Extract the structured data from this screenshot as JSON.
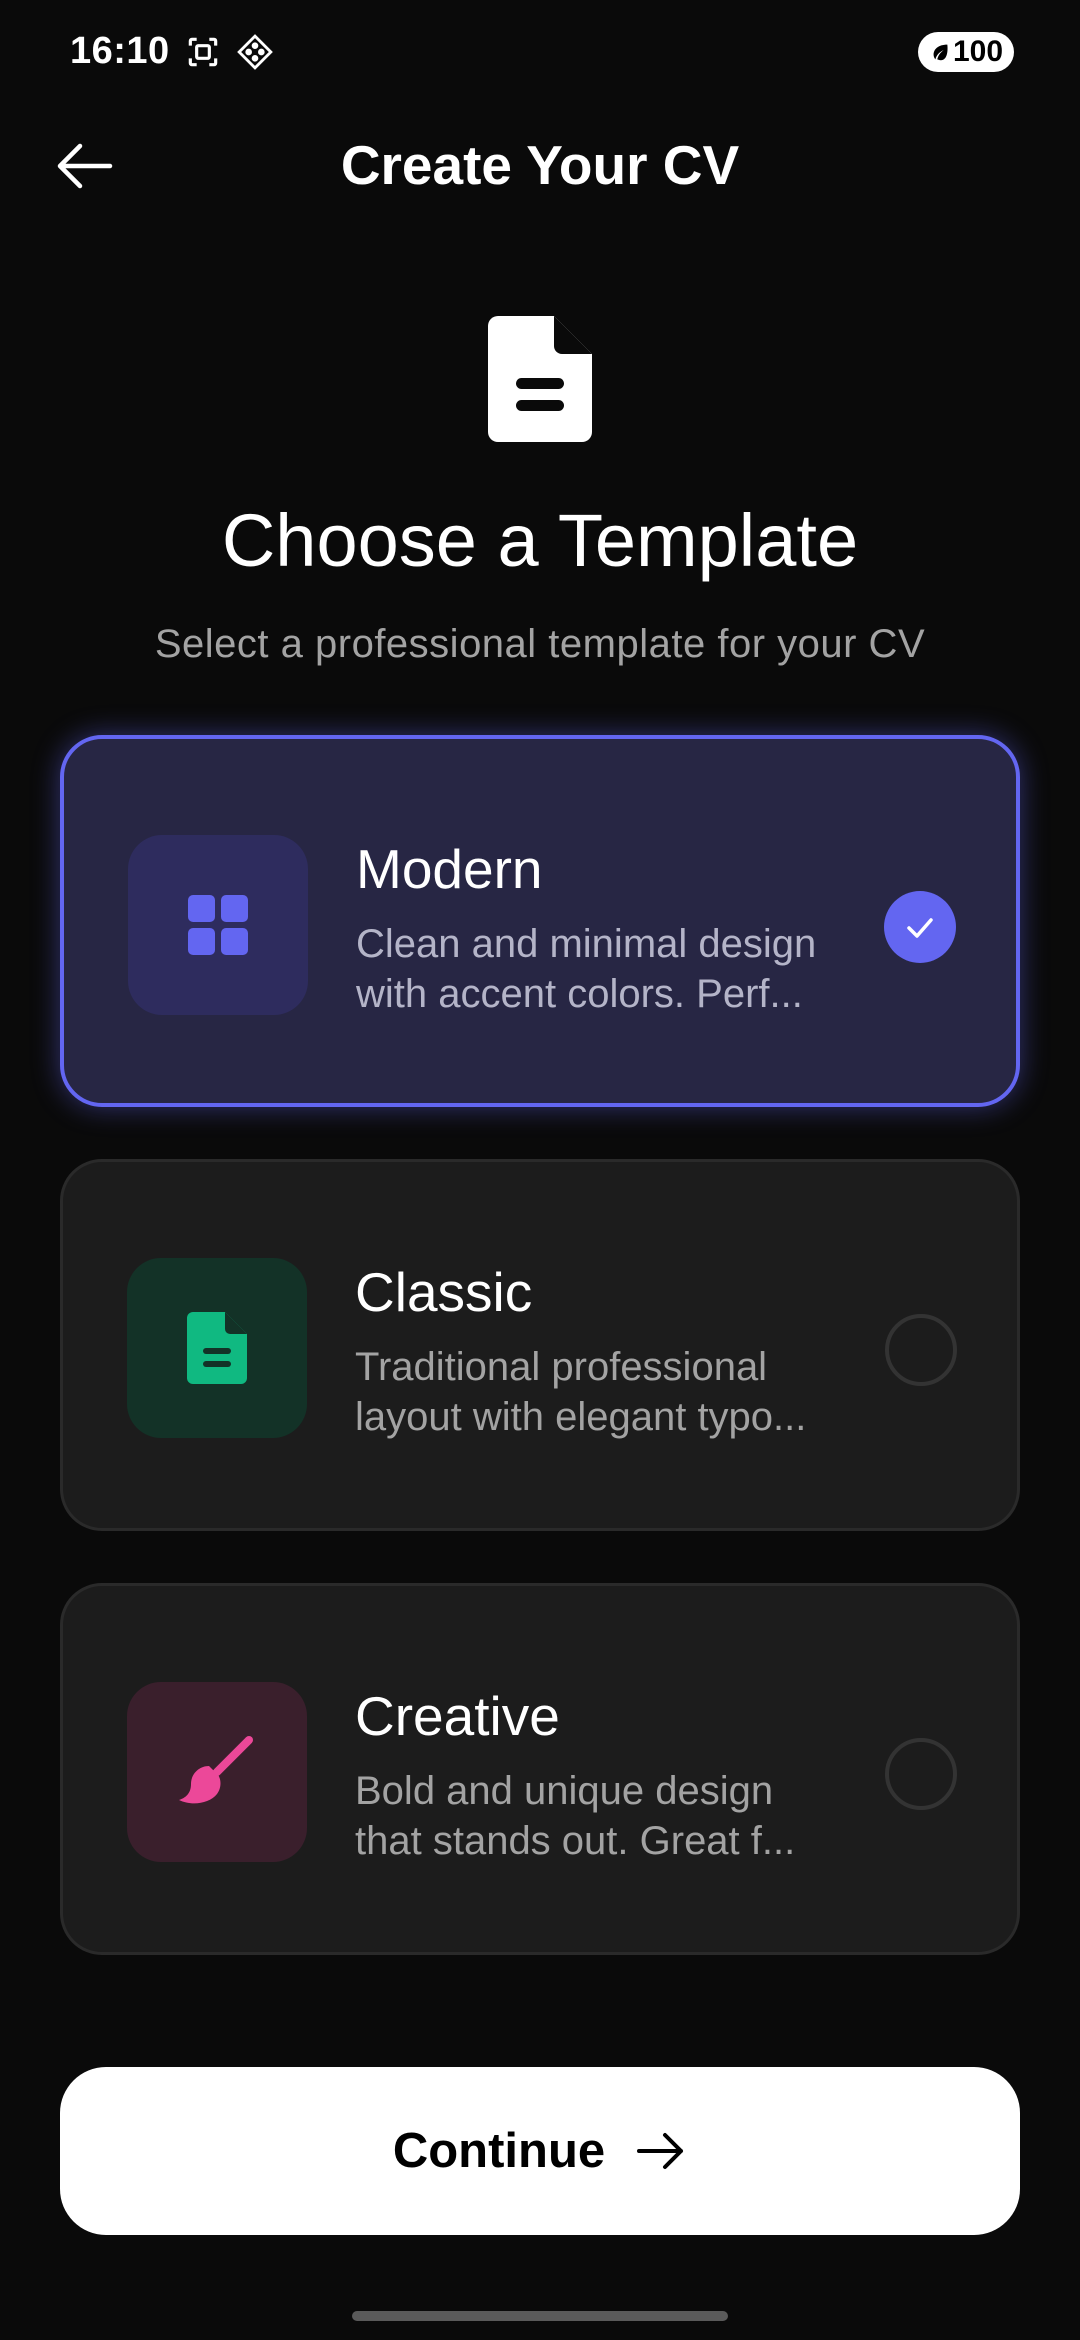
{
  "status_bar": {
    "time": "16:10",
    "battery": "100",
    "icons": [
      "screenshot-icon",
      "assistant-icon",
      "battery-saver-icon"
    ]
  },
  "header": {
    "title": "Create Your CV",
    "back_icon": "arrow-left-icon"
  },
  "hero": {
    "icon": "document-icon",
    "heading": "Choose a Template",
    "subheading": "Select a professional template for your CV"
  },
  "templates": [
    {
      "title": "Modern",
      "description": "Clean and minimal design\nwith accent colors. Perf...",
      "icon": "grid-icon",
      "selected": true,
      "accent": "#6366f1",
      "thumb_bg": "#2e2c5e"
    },
    {
      "title": "Classic",
      "description": "Traditional professional\nlayout with elegant typo...",
      "icon": "document-icon",
      "selected": false,
      "accent": "#10b981",
      "thumb_bg": "#133227"
    },
    {
      "title": "Creative",
      "description": "Bold and unique design\nthat stands out. Great f...",
      "icon": "paintbrush-icon",
      "selected": false,
      "accent": "#ec4899",
      "thumb_bg": "#3a1f2c"
    }
  ],
  "continue_button": {
    "label": "Continue",
    "icon": "arrow-right-icon"
  },
  "colors": {
    "background": "#0a0a0a",
    "accent": "#6366f1",
    "card": "#1c1c1c",
    "text_muted": "#a3a3a3"
  }
}
